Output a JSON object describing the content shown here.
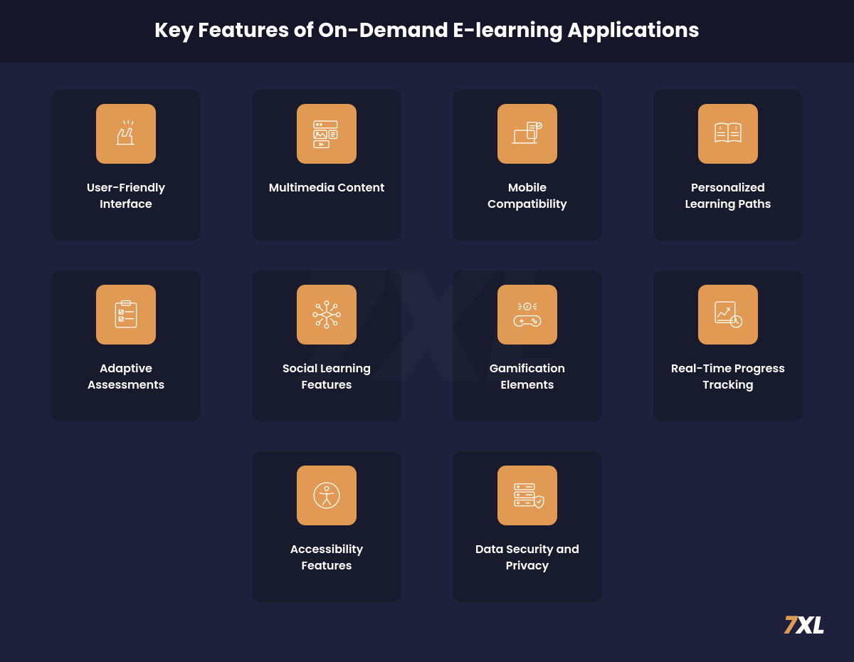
{
  "header": {
    "title": "Key Features of On-Demand E-learning Applications"
  },
  "brand": {
    "seven": "7",
    "xl": "XL"
  },
  "colors": {
    "accent": "#e09a53",
    "card": "#181a2e",
    "page": "#1f203b",
    "header": "#15162a"
  },
  "cards": [
    {
      "icon": "high-five-icon",
      "label": "User-Friendly Interface"
    },
    {
      "icon": "multimedia-icon",
      "label": "Multimedia Content"
    },
    {
      "icon": "mobile-laptop-icon",
      "label": "Mobile Compatibility"
    },
    {
      "icon": "open-book-icon",
      "label": "Personalized Learning Paths"
    },
    {
      "icon": "checklist-icon",
      "label": "Adaptive Assessments"
    },
    {
      "icon": "network-cap-icon",
      "label": "Social Learning Features"
    },
    {
      "icon": "gamepad-coin-icon",
      "label": "Gamification Elements"
    },
    {
      "icon": "chart-clock-icon",
      "label": "Real-Time Progress Tracking"
    },
    {
      "icon": "accessibility-icon",
      "label": "Accessibility Features"
    },
    {
      "icon": "server-shield-icon",
      "label": "Data Security and Privacy"
    }
  ]
}
